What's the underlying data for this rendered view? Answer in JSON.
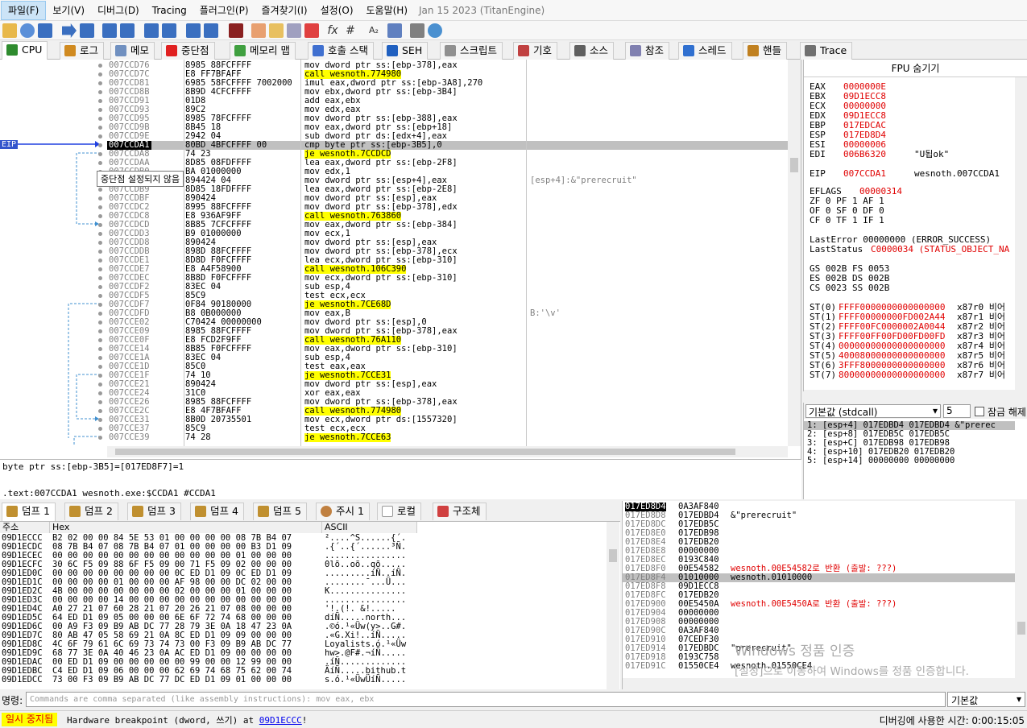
{
  "menu": {
    "items": [
      "파일(F)",
      "보기(V)",
      "디버그(D)",
      "Tracing",
      "플러그인(P)",
      "즐겨찾기(I)",
      "설정(O)",
      "도움말(H)"
    ],
    "title": "Jan 15 2023 (TitanEngine)"
  },
  "tabs": [
    {
      "label": "CPU",
      "color": "#2e8b2e"
    },
    {
      "label": "로그",
      "color": "#d08a20"
    },
    {
      "label": "메모",
      "color": "#7090c0"
    },
    {
      "label": "중단점",
      "color": "#e02020"
    },
    {
      "label": "메모리 맵",
      "color": "#40a040"
    },
    {
      "label": "호출 스택",
      "color": "#4070d0"
    },
    {
      "label": "SEH",
      "color": "#2060c0"
    },
    {
      "label": "스크립트",
      "color": "#909090"
    },
    {
      "label": "기호",
      "color": "#c04040"
    },
    {
      "label": "소스",
      "color": "#606060"
    },
    {
      "label": "참조",
      "color": "#8080b0"
    },
    {
      "label": "스레드",
      "color": "#3070d0"
    },
    {
      "label": "핸들",
      "color": "#c08020"
    },
    {
      "label": "Trace",
      "color": "#707070"
    }
  ],
  "disasm": [
    {
      "addr": "007CCD76",
      "bytes": "8985 88FCFFFF",
      "instr": "mov dword ptr ss:[ebp-378],eax",
      "comment": ""
    },
    {
      "addr": "007CCD7C",
      "bytes": "E8 FF7BFAFF",
      "instr": "call wesnoth.774980",
      "comment": "",
      "hl": true
    },
    {
      "addr": "007CCD81",
      "bytes": "6985 58FCFFFF 7002000",
      "instr": "imul eax,dword ptr ss:[ebp-3A8],270",
      "comment": ""
    },
    {
      "addr": "007CCD8B",
      "bytes": "8B9D 4CFCFFFF",
      "instr": "mov ebx,dword ptr ss:[ebp-3B4]",
      "comment": ""
    },
    {
      "addr": "007CCD91",
      "bytes": "01D8",
      "instr": "add eax,ebx",
      "comment": ""
    },
    {
      "addr": "007CCD93",
      "bytes": "89C2",
      "instr": "mov edx,eax",
      "comment": ""
    },
    {
      "addr": "007CCD95",
      "bytes": "8985 78FCFFFF",
      "instr": "mov dword ptr ss:[ebp-388],eax",
      "comment": ""
    },
    {
      "addr": "007CCD9B",
      "bytes": "8B45 18",
      "instr": "mov eax,dword ptr ss:[ebp+18]",
      "comment": ""
    },
    {
      "addr": "007CCD9E",
      "bytes": "2942 04",
      "instr": "sub dword ptr ds:[edx+4],eax",
      "comment": ""
    },
    {
      "addr": "007CCDA1",
      "bytes": "80BD 4BFCFFFF 00",
      "instr": "cmp byte ptr ss:[ebp-3B5],0",
      "comment": "",
      "sel": true
    },
    {
      "addr": "007CCDA8",
      "bytes": "74 23",
      "instr": "je wesnoth.7CCDCD",
      "comment": "",
      "hl": true
    },
    {
      "addr": "007CCDAA",
      "bytes": "8D85 08FDFFFF",
      "instr": "lea eax,dword ptr ss:[ebp-2F8]",
      "comment": ""
    },
    {
      "addr": "007CCDB0",
      "bytes": "BA 01000000",
      "instr": "mov edx,1",
      "comment": ""
    },
    {
      "addr": "007CCDB5",
      "bytes": "894424 04",
      "instr": "mov dword ptr ss:[esp+4],eax",
      "comment": "[esp+4]:&\"prerecruit\""
    },
    {
      "addr": "007CCDB9",
      "bytes": "8D85 18FDFFFF",
      "instr": "lea eax,dword ptr ss:[ebp-2E8]",
      "comment": ""
    },
    {
      "addr": "007CCDBF",
      "bytes": "890424",
      "instr": "mov dword ptr ss:[esp],eax",
      "comment": ""
    },
    {
      "addr": "007CCDC2",
      "bytes": "8995 88FCFFFF",
      "instr": "mov dword ptr ss:[ebp-378],edx",
      "comment": ""
    },
    {
      "addr": "007CCDC8",
      "bytes": "E8 936AF9FF",
      "instr": "call wesnoth.763860",
      "comment": "",
      "hl": true
    },
    {
      "addr": "007CCDCD",
      "bytes": "8B85 7CFCFFFF",
      "instr": "mov eax,dword ptr ss:[ebp-384]",
      "comment": ""
    },
    {
      "addr": "007CCDD3",
      "bytes": "B9 01000000",
      "instr": "mov ecx,1",
      "comment": ""
    },
    {
      "addr": "007CCDD8",
      "bytes": "890424",
      "instr": "mov dword ptr ss:[esp],eax",
      "comment": ""
    },
    {
      "addr": "007CCDDB",
      "bytes": "898D 88FCFFFF",
      "instr": "mov dword ptr ss:[ebp-378],ecx",
      "comment": ""
    },
    {
      "addr": "007CCDE1",
      "bytes": "8D8D F0FCFFFF",
      "instr": "lea ecx,dword ptr ss:[ebp-310]",
      "comment": ""
    },
    {
      "addr": "007CCDE7",
      "bytes": "E8 A4F58900",
      "instr": "call wesnoth.106C390",
      "comment": "",
      "hl": true
    },
    {
      "addr": "007CCDEC",
      "bytes": "8B8D F0FCFFFF",
      "instr": "mov ecx,dword ptr ss:[ebp-310]",
      "comment": ""
    },
    {
      "addr": "007CCDF2",
      "bytes": "83EC 04",
      "instr": "sub esp,4",
      "comment": ""
    },
    {
      "addr": "007CCDF5",
      "bytes": "85C9",
      "instr": "test ecx,ecx",
      "comment": ""
    },
    {
      "addr": "007CCDF7",
      "bytes": "0F84 90180000",
      "instr": "je wesnoth.7CE68D",
      "comment": "",
      "hl": true
    },
    {
      "addr": "007CCDFD",
      "bytes": "B8 0B000000",
      "instr": "mov eax,B",
      "comment": "B:'\\v'"
    },
    {
      "addr": "007CCE02",
      "bytes": "C70424 00000000",
      "instr": "mov dword ptr ss:[esp],0",
      "comment": ""
    },
    {
      "addr": "007CCE09",
      "bytes": "8985 88FCFFFF",
      "instr": "mov dword ptr ss:[ebp-378],eax",
      "comment": ""
    },
    {
      "addr": "007CCE0F",
      "bytes": "E8 FCD2F9FF",
      "instr": "call wesnoth.76A110",
      "comment": "",
      "hl": true
    },
    {
      "addr": "007CCE14",
      "bytes": "8B85 F0FCFFFF",
      "instr": "mov eax,dword ptr ss:[ebp-310]",
      "comment": ""
    },
    {
      "addr": "007CCE1A",
      "bytes": "83EC 04",
      "instr": "sub esp,4",
      "comment": ""
    },
    {
      "addr": "007CCE1D",
      "bytes": "85C0",
      "instr": "test eax,eax",
      "comment": ""
    },
    {
      "addr": "007CCE1F",
      "bytes": "74 10",
      "instr": "je wesnoth.7CCE31",
      "comment": "",
      "hl": true
    },
    {
      "addr": "007CCE21",
      "bytes": "890424",
      "instr": "mov dword ptr ss:[esp],eax",
      "comment": ""
    },
    {
      "addr": "007CCE24",
      "bytes": "31C0",
      "instr": "xor eax,eax",
      "comment": ""
    },
    {
      "addr": "007CCE26",
      "bytes": "8985 88FCFFFF",
      "instr": "mov dword ptr ss:[ebp-378],eax",
      "comment": ""
    },
    {
      "addr": "007CCE2C",
      "bytes": "E8 4F7BFAFF",
      "instr": "call wesnoth.774980",
      "comment": "",
      "hl": true
    },
    {
      "addr": "007CCE31",
      "bytes": "8B0D 20735501",
      "instr": "mov ecx,dword ptr ds:[1557320]",
      "comment": ""
    },
    {
      "addr": "007CCE37",
      "bytes": "85C9",
      "instr": "test ecx,ecx",
      "comment": ""
    },
    {
      "addr": "007CCE39",
      "bytes": "74 28",
      "instr": "je wesnoth.7CCE63",
      "comment": "",
      "hl": true
    }
  ],
  "tooltip": "중단점 설정되지 않음",
  "eip_label": "EIP",
  "info": {
    "line1": "byte ptr ss:[ebp-3B5]=[017ED8F7]=1",
    "line2": ".text:007CCDA1 wesnoth.exe:$CCDA1 #CCDA1"
  },
  "fpu_title": "FPU 숨기기",
  "registers": [
    {
      "name": "EAX",
      "value": "0000000E",
      "extra": ""
    },
    {
      "name": "EBX",
      "value": "09D1ECC8",
      "extra": ""
    },
    {
      "name": "ECX",
      "value": "00000000",
      "extra": ""
    },
    {
      "name": "EDX",
      "value": "09D1ECC8",
      "extra": ""
    },
    {
      "name": "EBP",
      "value": "017EDCAC",
      "extra": ""
    },
    {
      "name": "ESP",
      "value": "017ED8D4",
      "extra": ""
    },
    {
      "name": "ESI",
      "value": "00000006",
      "extra": ""
    },
    {
      "name": "EDI",
      "value": "006B6320",
      "extra": "\"U됩ok\""
    },
    {
      "name": "EIP",
      "value": "007CCDA1",
      "extra": "wesnoth.007CCDA1"
    }
  ],
  "flags": {
    "eflags_label": "EFLAGS",
    "eflags": "00000314",
    "line1": "ZF 0  PF 1  AF 1",
    "line2": "OF 0  SF 0  DF 0",
    "line3": "CF 0  TF 1  IF 1"
  },
  "errors": {
    "last_error": "LastError  00000000 (ERROR_SUCCESS)",
    "last_status_label": "LastStatus",
    "last_status": "C0000034 (STATUS_OBJECT_NA"
  },
  "segments": [
    "GS 002B  FS 0053",
    "ES 002B  DS 002B",
    "CS 0023  SS 002B"
  ],
  "fpu_stack": [
    {
      "name": "ST(0)",
      "value": "FFFF0000000000000000",
      "tag": "x87r0 비어"
    },
    {
      "name": "ST(1)",
      "value": "FFFF00000000FD002A44",
      "tag": "x87r1 비어"
    },
    {
      "name": "ST(2)",
      "value": "FFFF00FC0000002A0044",
      "tag": "x87r2 비어"
    },
    {
      "name": "ST(3)",
      "value": "FFFF00FF00FD00FD00FD",
      "tag": "x87r3 비어"
    },
    {
      "name": "ST(4)",
      "value": "00000000000000000000",
      "tag": "x87r4 비어"
    },
    {
      "name": "ST(5)",
      "value": "40008000000000000000",
      "tag": "x87r5 비어"
    },
    {
      "name": "ST(6)",
      "value": "3FFF8000000000000000",
      "tag": "x87r6 비어"
    },
    {
      "name": "ST(7)",
      "value": "80000000000000000000",
      "tag": "x87r7 비어"
    }
  ],
  "callconv": {
    "select": "기본값 (stdcall)",
    "count": "5",
    "lock": "잠금 해제"
  },
  "callstack_args": [
    "1: [esp+4] 017EDBD4 017EDBD4 &\"prerec",
    "2: [esp+8] 017EDB5C 017EDB5C",
    "3: [esp+C] 017EDB98 017EDB98",
    "4: [esp+10] 017EDB20 017EDB20",
    "5: [esp+14] 00000000 00000000"
  ],
  "dump_tabs": [
    "덤프 1",
    "덤프 2",
    "덤프 3",
    "덤프 4",
    "덤프 5",
    "주시 1",
    "로컬",
    "구조체"
  ],
  "dump_headers": {
    "addr": "주소",
    "hex": "Hex",
    "ascii": "ASCII"
  },
  "dump_rows": [
    {
      "addr": "09D1ECCC",
      "hex": "B2 02 00 00  84 5E 53 01  00 00 00 00  08 7B B4 07",
      "ascii": "²....^S......{´."
    },
    {
      "addr": "09D1ECDC",
      "hex": "08 7B B4 07  08 7B B4 07  01 00 00 00  00 B3 D1 09",
      "ascii": ".{´..{´......³Ñ."
    },
    {
      "addr": "09D1ECEC",
      "hex": "00 00 00 00  00 00 00 00  00 00 00 00  01 00 00 00",
      "ascii": "................"
    },
    {
      "addr": "09D1ECFC",
      "hex": "30 6C F5 09  88 6F F5 09  00 71 F5 09  02 00 00 00",
      "ascii": "0lõ..oõ..qõ....."
    },
    {
      "addr": "09D1ED0C",
      "hex": "00 00 00 00  00 00 00 00  0C ED D1 09  0C ED D1 09",
      "ascii": ".........íÑ..íÑ."
    },
    {
      "addr": "09D1ED1C",
      "hex": "00 00 00 00  01 00 00 00  AF 98 00 00  DC 02 00 00",
      "ascii": "........¯...Ü..."
    },
    {
      "addr": "09D1ED2C",
      "hex": "4B 00 00 00  00 00 00 00  02 00 00 00  01 00 00 00",
      "ascii": "K..............."
    },
    {
      "addr": "09D1ED3C",
      "hex": "00 00 00 00  14 00 00 00  00 00 00 00  00 00 00 00",
      "ascii": "................"
    },
    {
      "addr": "09D1ED4C",
      "hex": "A0 27 21 07  60 28 21 07  20 26 21 07  08 00 00 00",
      "ascii": " '!.(!. &!....."
    },
    {
      "addr": "09D1ED5C",
      "hex": "64 ED D1 09  05 00 00 00  6E 6F 72 74  68 00 00 00",
      "ascii": "díÑ.....north..."
    },
    {
      "addr": "09D1ED6C",
      "hex": "00 A9 F3 09  B9 AB DC 77  28 79 3E 0A  18 47 23 0A",
      "ascii": ".©ó.¹«Üw(y>..G#."
    },
    {
      "addr": "09D1ED7C",
      "hex": "80 AB 47 05  58 69 21 0A  8C ED D1 09  09 00 00 00",
      "ascii": ".«G.Xi!..íÑ....."
    },
    {
      "addr": "09D1ED8C",
      "hex": "4C 6F 79 61  6C 69 73 74  73 00 F3 09  B9 AB DC 77",
      "ascii": "Loyalists.ó.¹«Üw"
    },
    {
      "addr": "09D1ED9C",
      "hex": "68 77 3E 0A  40 46 23 0A  AC ED D1 09  00 00 00 00",
      "ascii": "hw>.@F#.¬íÑ....."
    },
    {
      "addr": "09D1EDAC",
      "hex": "00 ED D1 09  00 00 00 00  00 99 00 00  12 99 00 00",
      "ascii": ".íÑ............."
    },
    {
      "addr": "09D1EDBC",
      "hex": "C4 ED D1 09  06 00 00 00  62 69 74 68  75 62 00 74",
      "ascii": "ÄíÑ.....bithub.t"
    },
    {
      "addr": "09D1EDCC",
      "hex": "73 00 F3 09  B9 AB DC 77  DC ED D1 09  01 00 00 00",
      "ascii": "s.ó.¹«ÜwÜíÑ....."
    }
  ],
  "stack_rows": [
    {
      "addr": "017ED8D4",
      "val": "0A3AF840",
      "comment": "",
      "top": true
    },
    {
      "addr": "017ED8D8",
      "val": "017EDBD4",
      "comment": "&\"prerecruit\""
    },
    {
      "addr": "017ED8DC",
      "val": "017EDB5C",
      "comment": ""
    },
    {
      "addr": "017ED8E0",
      "val": "017EDB98",
      "comment": ""
    },
    {
      "addr": "017ED8E4",
      "val": "017EDB20",
      "comment": ""
    },
    {
      "addr": "017ED8E8",
      "val": "00000000",
      "comment": ""
    },
    {
      "addr": "017ED8EC",
      "val": "0193C840",
      "comment": ""
    },
    {
      "addr": "017ED8F0",
      "val": "00E54582",
      "comment": "wesnoth.00E54582로 반환 (출발: ???)",
      "red": true
    },
    {
      "addr": "017ED8F4",
      "val": "01010000",
      "comment": "wesnoth.01010000",
      "sel": true
    },
    {
      "addr": "017ED8F8",
      "val": "09D1ECC8",
      "comment": ""
    },
    {
      "addr": "017ED8FC",
      "val": "017EDB20",
      "comment": ""
    },
    {
      "addr": "017ED900",
      "val": "00E5450A",
      "comment": "wesnoth.00E5450A로 반환 (출발: ???)",
      "red": true
    },
    {
      "addr": "017ED904",
      "val": "00000000",
      "comment": ""
    },
    {
      "addr": "017ED908",
      "val": "00000000",
      "comment": ""
    },
    {
      "addr": "017ED90C",
      "val": "0A3AF840",
      "comment": ""
    },
    {
      "addr": "017ED910",
      "val": "07CEDF30",
      "comment": ""
    },
    {
      "addr": "017ED914",
      "val": "017EDBDC",
      "comment": "\"prerecruit\""
    },
    {
      "addr": "017ED918",
      "val": "0193C758",
      "comment": ""
    },
    {
      "addr": "017ED91C",
      "val": "01550CE4",
      "comment": "wesnoth.01550CE4"
    }
  ],
  "watermark": {
    "line1": "Windows 정품 인증",
    "line2": "[설정]으로 이동하여 Windows를 정품 인증합니다."
  },
  "command": {
    "label": "명령:",
    "placeholder": "Commands are comma separated (like assembly instructions): mov eax, ebx",
    "select": "기본값"
  },
  "status": {
    "paused": "일시 중지됨",
    "message_prefix": "Hardware breakpoint (dword, 쓰기) at ",
    "message_addr": "09D1ECCC",
    "message_suffix": "!",
    "time": "디버깅에 사용한 시간: 0:00:15:05"
  }
}
